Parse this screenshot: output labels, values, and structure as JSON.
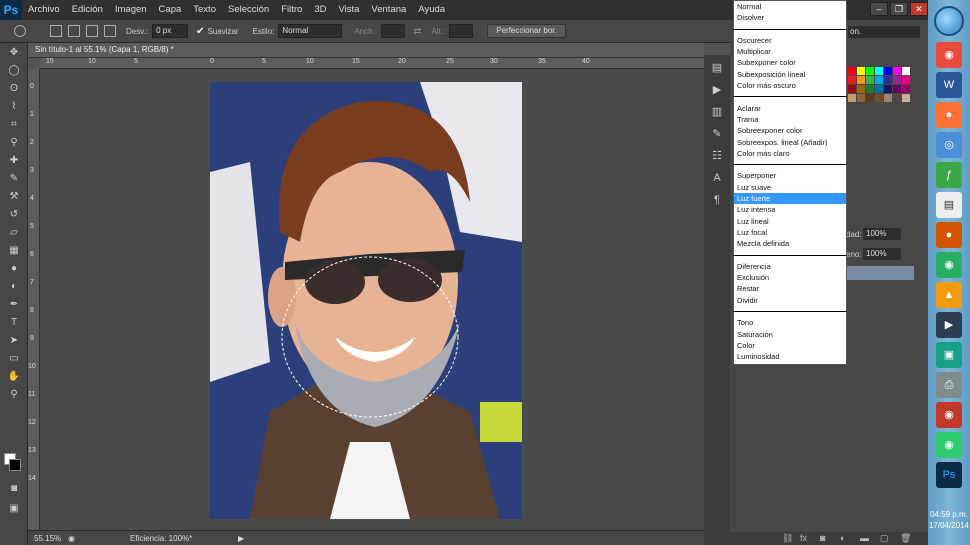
{
  "app": {
    "logo": "Ps"
  },
  "menubar": {
    "items": [
      "Archivo",
      "Edición",
      "Imagen",
      "Capa",
      "Texto",
      "Selección",
      "Filtro",
      "3D",
      "Vista",
      "Ventana",
      "Ayuda"
    ]
  },
  "options": {
    "feather_label": "Desv.:",
    "feather_value": "0 px",
    "antialias_label": "Suavizar",
    "style_label": "Estilo:",
    "style_value": "Normal",
    "width_label": "Anch.:",
    "height_label": "Alt.:",
    "refine_button": "Perfeccionar bor."
  },
  "document": {
    "tab_title": "Sin título-1 al 55.1% (Capa 1, RGB/8) *",
    "ruler_h": [
      "15",
      "10",
      "5",
      "0",
      "5",
      "10",
      "15",
      "20",
      "25",
      "30",
      "35",
      "40"
    ],
    "ruler_v": [
      "0",
      "1",
      "2",
      "3",
      "4",
      "5",
      "6",
      "7",
      "8",
      "9",
      "10",
      "11",
      "12",
      "13",
      "14"
    ],
    "zoom": "55.15%",
    "efficiency": "Eficiencia: 100%*"
  },
  "blend_menu": {
    "groups": [
      [
        "Normal",
        "Disolver"
      ],
      [
        "Oscurecer",
        "Multiplicar",
        "Subexponer color",
        "Subexposición lineal",
        "Color más oscuro"
      ],
      [
        "Aclarar",
        "Trama",
        "Sobreexponer color",
        "Sobreexpos. lineal (Añadir)",
        "Color más claro"
      ],
      [
        "Superponer",
        "Luz suave",
        "Luz fuerte",
        "Luz intensa",
        "Luz lineal",
        "Luz focal",
        "Mezcla definida"
      ],
      [
        "Diferencia",
        "Exclusión",
        "Restar",
        "Dividir"
      ],
      [
        "Tono",
        "Saturación",
        "Color",
        "Luminosidad"
      ]
    ],
    "selected": "Luz fuerte"
  },
  "layers": {
    "opacity_label": "dad:",
    "opacity_value": "100%",
    "fill_label": "eno:",
    "fill_value": "100%",
    "essentials_partial": "on."
  },
  "taskbar": {
    "time": "04:59 p.m.",
    "date": "17/04/2014"
  }
}
